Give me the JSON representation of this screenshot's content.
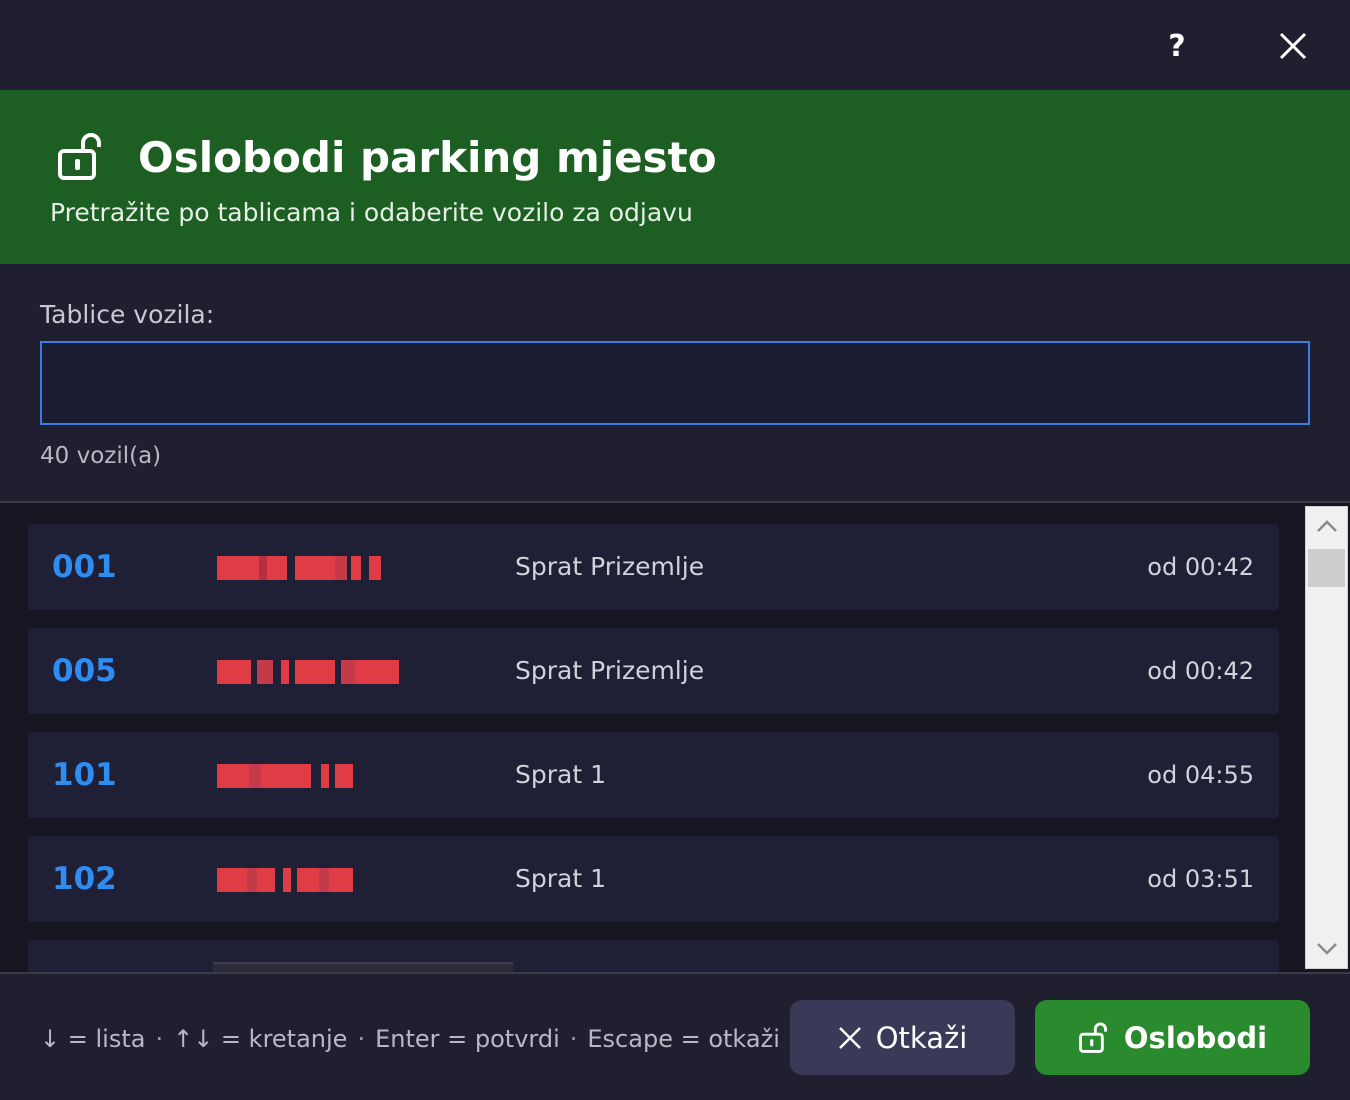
{
  "titlebar": {
    "help_label": "?",
    "close_icon": "close-icon"
  },
  "header": {
    "icon": "unlock-icon",
    "title": "Oslobodi parking mjesto",
    "subtitle": "Pretražite po tablicama i odaberite vozilo za odjavu"
  },
  "search": {
    "label": "Tablice vozila:",
    "value": "",
    "count_text": "40 vozil(a)"
  },
  "rows": [
    {
      "number": "001",
      "floor": "Sprat Prizemlje",
      "time": "od 00:42"
    },
    {
      "number": "005",
      "floor": "Sprat Prizemlje",
      "time": "od 00:42"
    },
    {
      "number": "101",
      "floor": "Sprat 1",
      "time": "od 04:55"
    },
    {
      "number": "102",
      "floor": "Sprat 1",
      "time": "od 03:51"
    }
  ],
  "footer": {
    "hints": [
      "↓ = lista",
      "↑↓ = kretanje",
      "Enter = potvrdi",
      "Escape = otkaži"
    ],
    "hint_separator": "·",
    "cancel_label": "Otkaži",
    "release_label": "Oslobodi"
  },
  "colors": {
    "header_green": "#1d5e22",
    "accent_blue": "#2f8cf0",
    "release_green": "#2a8a2e",
    "redacted_plate": "#e03c46"
  }
}
